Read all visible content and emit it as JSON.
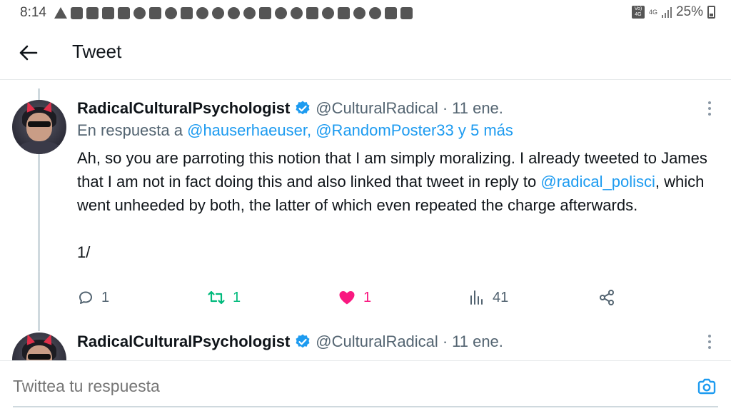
{
  "status_bar": {
    "time": "8:14",
    "battery": "25%",
    "network_label": "4G",
    "volte_label": "Vo) 4G",
    "icons": [
      "alert-icon",
      "chat-icon",
      "facebook-icon",
      "youtube-icon",
      "youtube-icon",
      "messenger-icon",
      "calendar-icon",
      "twitter-icon",
      "pocket-icon",
      "cast-icon",
      "app-icon",
      "app-icon",
      "app-icon",
      "gmail-icon",
      "location-icon",
      "location-icon",
      "youtube-icon",
      "whatsapp-icon",
      "shopping-icon",
      "location-icon",
      "cloud-icon",
      "card-icon",
      "card-icon"
    ]
  },
  "header": {
    "back_icon": "arrow-left-icon",
    "title": "Tweet"
  },
  "tweets": [
    {
      "display_name": "RadicalCulturalPsychologist",
      "handle": "@CulturalRadical",
      "separator": "·",
      "date": "11 ene.",
      "reply_prefix": "En respuesta a",
      "reply_to": "@hauserhaeuser, @RandomPoster33 y 5 más",
      "text_part1": "Ah, so you are parroting this notion that I am simply moralizing. I already tweeted to James that I am not in fact doing this and also linked that tweet in reply to ",
      "text_mention": "@radical_polisci",
      "text_part2": ", which went unheeded by both, the latter of which even repeated the charge afterwards.",
      "text_footer": "1/",
      "reply_count": "1",
      "retweet_count": "1",
      "like_count": "1",
      "view_count": "41"
    },
    {
      "display_name": "RadicalCulturalPsychologist",
      "handle": "@CulturalRadical",
      "separator": "·",
      "date": "11 ene."
    }
  ],
  "composer": {
    "placeholder": "Twittea tu respuesta",
    "camera_icon": "camera-icon"
  },
  "colors": {
    "accent": "#1d9bf0",
    "retweet": "#00ba7c",
    "like": "#f91880",
    "secondary_text": "#536471"
  }
}
